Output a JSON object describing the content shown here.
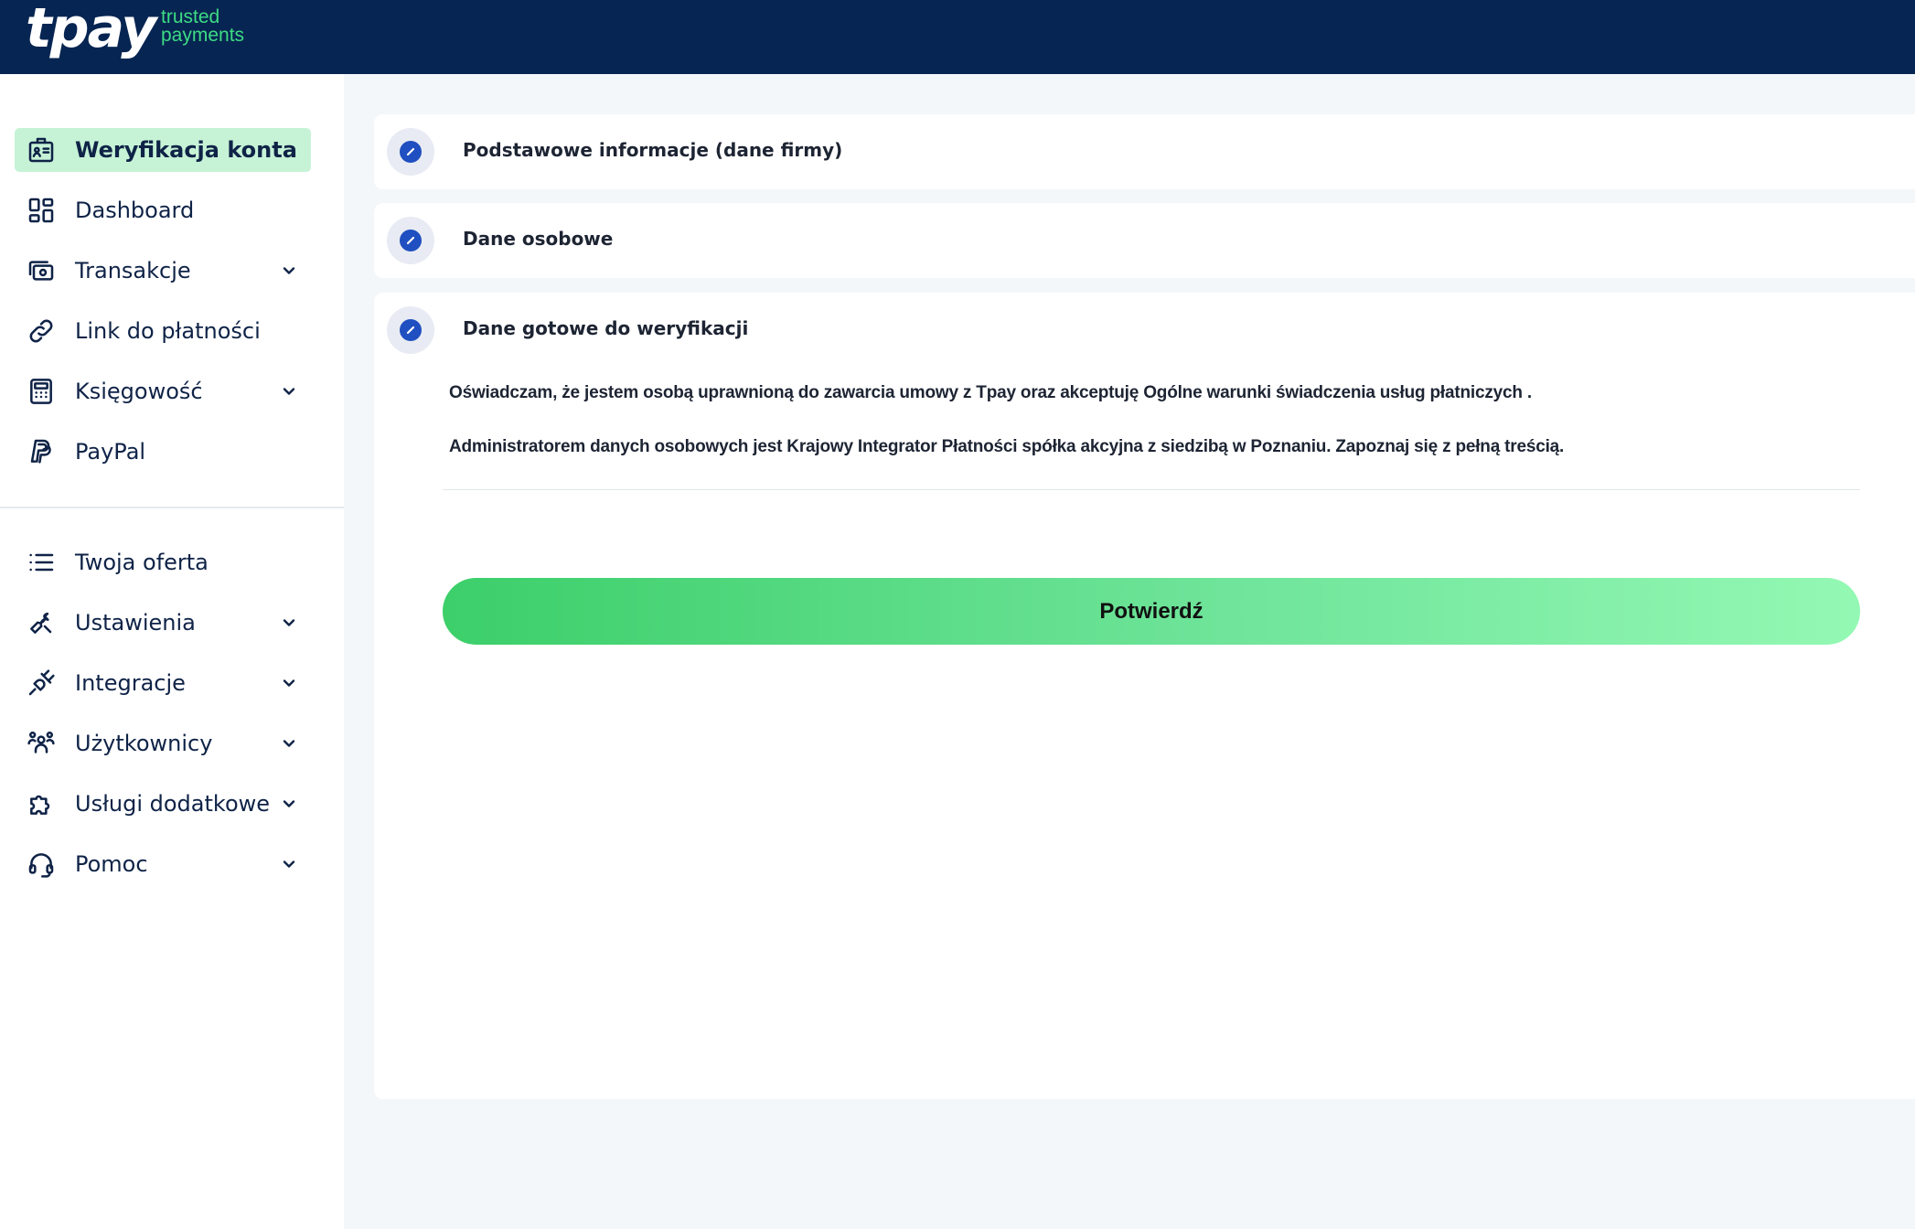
{
  "header": {
    "logo": "tpay",
    "tagline_line1": "trusted",
    "tagline_line2": "payments"
  },
  "sidebar": {
    "items": [
      {
        "label": "Weryfikacja konta",
        "icon": "id-card-icon",
        "active": true,
        "expandable": false
      },
      {
        "label": "Dashboard",
        "icon": "dashboard-icon",
        "active": false,
        "expandable": false
      },
      {
        "label": "Transakcje",
        "icon": "cash-icon",
        "active": false,
        "expandable": true
      },
      {
        "label": "Link do płatności",
        "icon": "link-icon",
        "active": false,
        "expandable": false
      },
      {
        "label": "Księgowość",
        "icon": "calculator-icon",
        "active": false,
        "expandable": true
      },
      {
        "label": "PayPal",
        "icon": "paypal-icon",
        "active": false,
        "expandable": false
      }
    ],
    "items2": [
      {
        "label": "Twoja oferta",
        "icon": "list-icon",
        "expandable": false
      },
      {
        "label": "Ustawienia",
        "icon": "wrench-icon",
        "expandable": true
      },
      {
        "label": "Integracje",
        "icon": "plug-icon",
        "expandable": true
      },
      {
        "label": "Użytkownicy",
        "icon": "users-icon",
        "expandable": true
      },
      {
        "label": "Usługi dodatkowe",
        "icon": "puzzle-icon",
        "expandable": true
      },
      {
        "label": "Pomoc",
        "icon": "headset-icon",
        "expandable": true
      }
    ]
  },
  "main": {
    "sections": [
      {
        "title": "Podstawowe informacje (dane firmy)",
        "icon": "edit-icon"
      },
      {
        "title": "Dane osobowe",
        "icon": "edit-icon"
      },
      {
        "title": "Dane gotowe do weryfikacji",
        "icon": "edit-icon"
      }
    ],
    "consent_line1": "Oświadczam, że jestem osobą uprawnioną do zawarcia umowy z Tpay oraz akceptuję Ogólne warunki świadczenia usług płatniczych .",
    "consent_line2": "Administratorem danych osobowych jest Krajowy Integrator Płatności spółka akcyjna z siedzibą w Poznaniu. Zapoznaj się z pełną treścią.",
    "confirm_label": "Potwierdź"
  },
  "colors": {
    "header_bg": "#072552",
    "accent_green": "#3ddc84",
    "active_bg": "#c6f3d6",
    "edit_blue": "#1f4fc0"
  }
}
